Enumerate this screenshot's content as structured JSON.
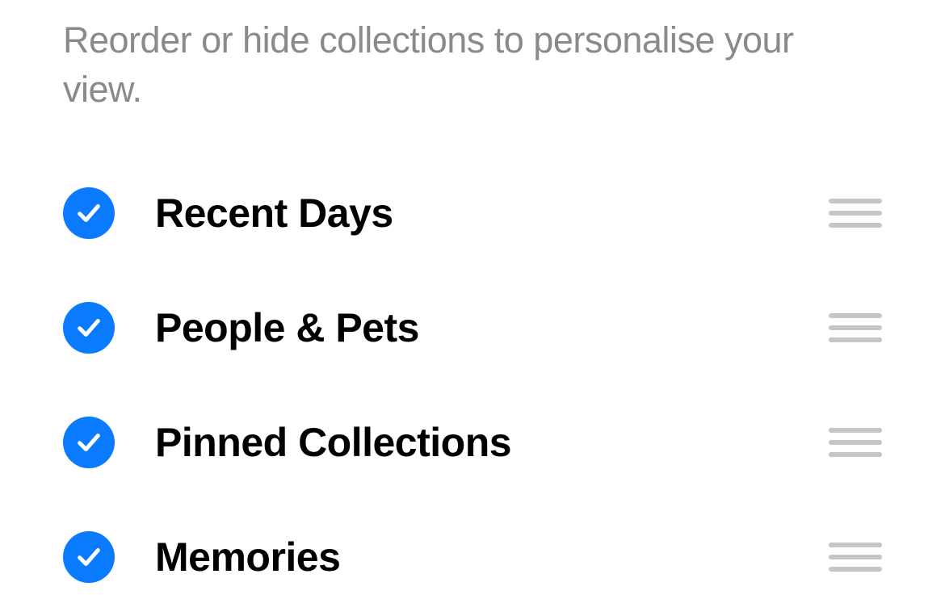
{
  "description": "Reorder or hide collections to personalise your view.",
  "colors": {
    "accent": "#0a7aff",
    "text_primary": "#000000",
    "text_secondary": "#8a8a8e",
    "drag_handle": "#c6c6c8"
  },
  "collections": [
    {
      "label": "Recent Days",
      "checked": true
    },
    {
      "label": "People & Pets",
      "checked": true
    },
    {
      "label": "Pinned Collections",
      "checked": true
    },
    {
      "label": "Memories",
      "checked": true
    }
  ]
}
